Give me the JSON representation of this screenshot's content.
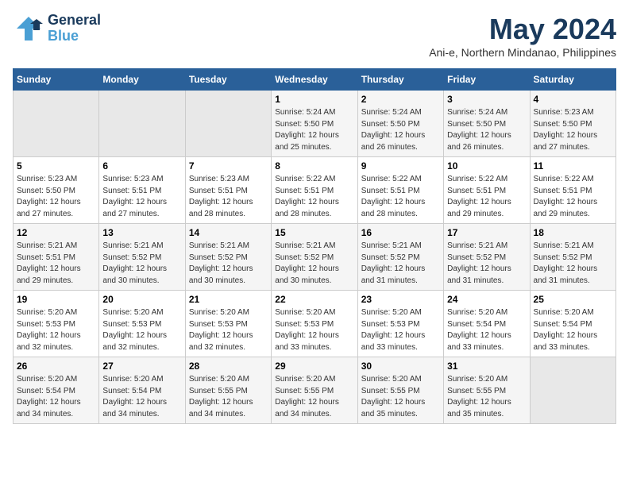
{
  "logo": {
    "general": "General",
    "blue": "Blue"
  },
  "header": {
    "month": "May 2024",
    "location": "Ani-e, Northern Mindanao, Philippines"
  },
  "weekdays": [
    "Sunday",
    "Monday",
    "Tuesday",
    "Wednesday",
    "Thursday",
    "Friday",
    "Saturday"
  ],
  "weeks": [
    [
      {
        "day": "",
        "info": ""
      },
      {
        "day": "",
        "info": ""
      },
      {
        "day": "",
        "info": ""
      },
      {
        "day": "1",
        "info": "Sunrise: 5:24 AM\nSunset: 5:50 PM\nDaylight: 12 hours\nand 25 minutes."
      },
      {
        "day": "2",
        "info": "Sunrise: 5:24 AM\nSunset: 5:50 PM\nDaylight: 12 hours\nand 26 minutes."
      },
      {
        "day": "3",
        "info": "Sunrise: 5:24 AM\nSunset: 5:50 PM\nDaylight: 12 hours\nand 26 minutes."
      },
      {
        "day": "4",
        "info": "Sunrise: 5:23 AM\nSunset: 5:50 PM\nDaylight: 12 hours\nand 27 minutes."
      }
    ],
    [
      {
        "day": "5",
        "info": "Sunrise: 5:23 AM\nSunset: 5:50 PM\nDaylight: 12 hours\nand 27 minutes."
      },
      {
        "day": "6",
        "info": "Sunrise: 5:23 AM\nSunset: 5:51 PM\nDaylight: 12 hours\nand 27 minutes."
      },
      {
        "day": "7",
        "info": "Sunrise: 5:23 AM\nSunset: 5:51 PM\nDaylight: 12 hours\nand 28 minutes."
      },
      {
        "day": "8",
        "info": "Sunrise: 5:22 AM\nSunset: 5:51 PM\nDaylight: 12 hours\nand 28 minutes."
      },
      {
        "day": "9",
        "info": "Sunrise: 5:22 AM\nSunset: 5:51 PM\nDaylight: 12 hours\nand 28 minutes."
      },
      {
        "day": "10",
        "info": "Sunrise: 5:22 AM\nSunset: 5:51 PM\nDaylight: 12 hours\nand 29 minutes."
      },
      {
        "day": "11",
        "info": "Sunrise: 5:22 AM\nSunset: 5:51 PM\nDaylight: 12 hours\nand 29 minutes."
      }
    ],
    [
      {
        "day": "12",
        "info": "Sunrise: 5:21 AM\nSunset: 5:51 PM\nDaylight: 12 hours\nand 29 minutes."
      },
      {
        "day": "13",
        "info": "Sunrise: 5:21 AM\nSunset: 5:52 PM\nDaylight: 12 hours\nand 30 minutes."
      },
      {
        "day": "14",
        "info": "Sunrise: 5:21 AM\nSunset: 5:52 PM\nDaylight: 12 hours\nand 30 minutes."
      },
      {
        "day": "15",
        "info": "Sunrise: 5:21 AM\nSunset: 5:52 PM\nDaylight: 12 hours\nand 30 minutes."
      },
      {
        "day": "16",
        "info": "Sunrise: 5:21 AM\nSunset: 5:52 PM\nDaylight: 12 hours\nand 31 minutes."
      },
      {
        "day": "17",
        "info": "Sunrise: 5:21 AM\nSunset: 5:52 PM\nDaylight: 12 hours\nand 31 minutes."
      },
      {
        "day": "18",
        "info": "Sunrise: 5:21 AM\nSunset: 5:52 PM\nDaylight: 12 hours\nand 31 minutes."
      }
    ],
    [
      {
        "day": "19",
        "info": "Sunrise: 5:20 AM\nSunset: 5:53 PM\nDaylight: 12 hours\nand 32 minutes."
      },
      {
        "day": "20",
        "info": "Sunrise: 5:20 AM\nSunset: 5:53 PM\nDaylight: 12 hours\nand 32 minutes."
      },
      {
        "day": "21",
        "info": "Sunrise: 5:20 AM\nSunset: 5:53 PM\nDaylight: 12 hours\nand 32 minutes."
      },
      {
        "day": "22",
        "info": "Sunrise: 5:20 AM\nSunset: 5:53 PM\nDaylight: 12 hours\nand 33 minutes."
      },
      {
        "day": "23",
        "info": "Sunrise: 5:20 AM\nSunset: 5:53 PM\nDaylight: 12 hours\nand 33 minutes."
      },
      {
        "day": "24",
        "info": "Sunrise: 5:20 AM\nSunset: 5:54 PM\nDaylight: 12 hours\nand 33 minutes."
      },
      {
        "day": "25",
        "info": "Sunrise: 5:20 AM\nSunset: 5:54 PM\nDaylight: 12 hours\nand 33 minutes."
      }
    ],
    [
      {
        "day": "26",
        "info": "Sunrise: 5:20 AM\nSunset: 5:54 PM\nDaylight: 12 hours\nand 34 minutes."
      },
      {
        "day": "27",
        "info": "Sunrise: 5:20 AM\nSunset: 5:54 PM\nDaylight: 12 hours\nand 34 minutes."
      },
      {
        "day": "28",
        "info": "Sunrise: 5:20 AM\nSunset: 5:55 PM\nDaylight: 12 hours\nand 34 minutes."
      },
      {
        "day": "29",
        "info": "Sunrise: 5:20 AM\nSunset: 5:55 PM\nDaylight: 12 hours\nand 34 minutes."
      },
      {
        "day": "30",
        "info": "Sunrise: 5:20 AM\nSunset: 5:55 PM\nDaylight: 12 hours\nand 35 minutes."
      },
      {
        "day": "31",
        "info": "Sunrise: 5:20 AM\nSunset: 5:55 PM\nDaylight: 12 hours\nand 35 minutes."
      },
      {
        "day": "",
        "info": ""
      }
    ]
  ]
}
